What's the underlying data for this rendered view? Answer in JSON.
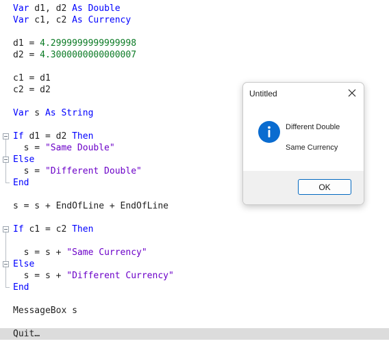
{
  "editor": {
    "lines": [
      {
        "kw1": "Var",
        "t1": " d1, d2 ",
        "kw2": "As Double"
      },
      {
        "kw1": "Var",
        "t1": " c1, c2 ",
        "kw2": "As Currency"
      },
      {
        "t1": "d1 = ",
        "num": "4.2999999999999998"
      },
      {
        "t1": "d2 = ",
        "num": "4.3000000000000007"
      },
      {
        "t1": "c1 = d1"
      },
      {
        "t1": "c2 = d2"
      },
      {
        "kw1": "Var",
        "t1": " s ",
        "kw2": "As String"
      },
      {
        "kw1": "If",
        "t1": " d1 = d2 ",
        "kw2": "Then"
      },
      {
        "t1": "  s = ",
        "str": "\"Same Double\""
      },
      {
        "kw1": "Else"
      },
      {
        "t1": "  s = ",
        "str": "\"Different Double\""
      },
      {
        "kw1": "End"
      },
      {
        "t1": "s = s + EndOfLine + EndOfLine"
      },
      {
        "kw1": "If",
        "t1": " c1 = c2 ",
        "kw2": "Then"
      },
      {
        "t1": "  s = s + ",
        "str": "\"Same Currency\""
      },
      {
        "kw1": "Else"
      },
      {
        "t1": "  s = s + ",
        "str": "\"Different Currency\""
      },
      {
        "kw1": "End"
      },
      {
        "t1": "MessageBox s"
      },
      {
        "t1": "Quit…"
      }
    ]
  },
  "dialog": {
    "title": "Untitled",
    "icon": "info-icon",
    "message_line1": "Different Double",
    "message_line2": "Same Currency",
    "ok_label": "OK"
  },
  "colors": {
    "keyword": "#0000ff",
    "string": "#6b00c8",
    "number": "#0a7a24",
    "info_icon": "#0a6cd0",
    "current_line": "#dcdcdc"
  }
}
